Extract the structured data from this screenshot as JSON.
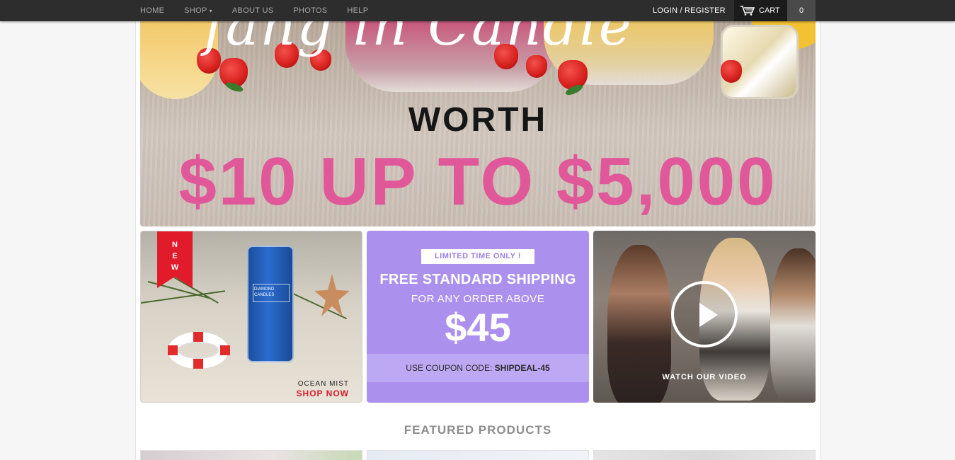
{
  "nav": {
    "items": [
      {
        "label": "HOME"
      },
      {
        "label": "SHOP"
      },
      {
        "label": "ABOUT US"
      },
      {
        "label": "PHOTOS"
      },
      {
        "label": "HELP"
      }
    ],
    "shop_caret": "▾",
    "login_label": "LOGIN / REGISTER",
    "cart_label": "CART",
    "cart_count": "0"
  },
  "hero": {
    "worth": "WORTH",
    "amount": "$10 UP TO $5,000"
  },
  "tiles": {
    "new_candle": {
      "badge_letters": [
        "N",
        "E",
        "W"
      ],
      "product_name": "OCEAN MIST",
      "cta": "SHOP NOW"
    },
    "shipping": {
      "banner": "LIMITED TIME ONLY !",
      "headline": "FREE STANDARD SHIPPING",
      "subline": "FOR ANY ORDER ABOVE",
      "price": "$45",
      "coupon_prefix": "USE COUPON CODE:",
      "coupon_code": "SHIPDEAL-45"
    },
    "video": {
      "caption": "WATCH OUR VIDEO"
    }
  },
  "featured": {
    "heading": "FEATURED PRODUCTS"
  },
  "colors": {
    "accent_pink": "#e0579a",
    "shipping_purple": "#ac90ee",
    "ribbon_red": "#e21b2a",
    "topbar": "#2d2d2d"
  }
}
